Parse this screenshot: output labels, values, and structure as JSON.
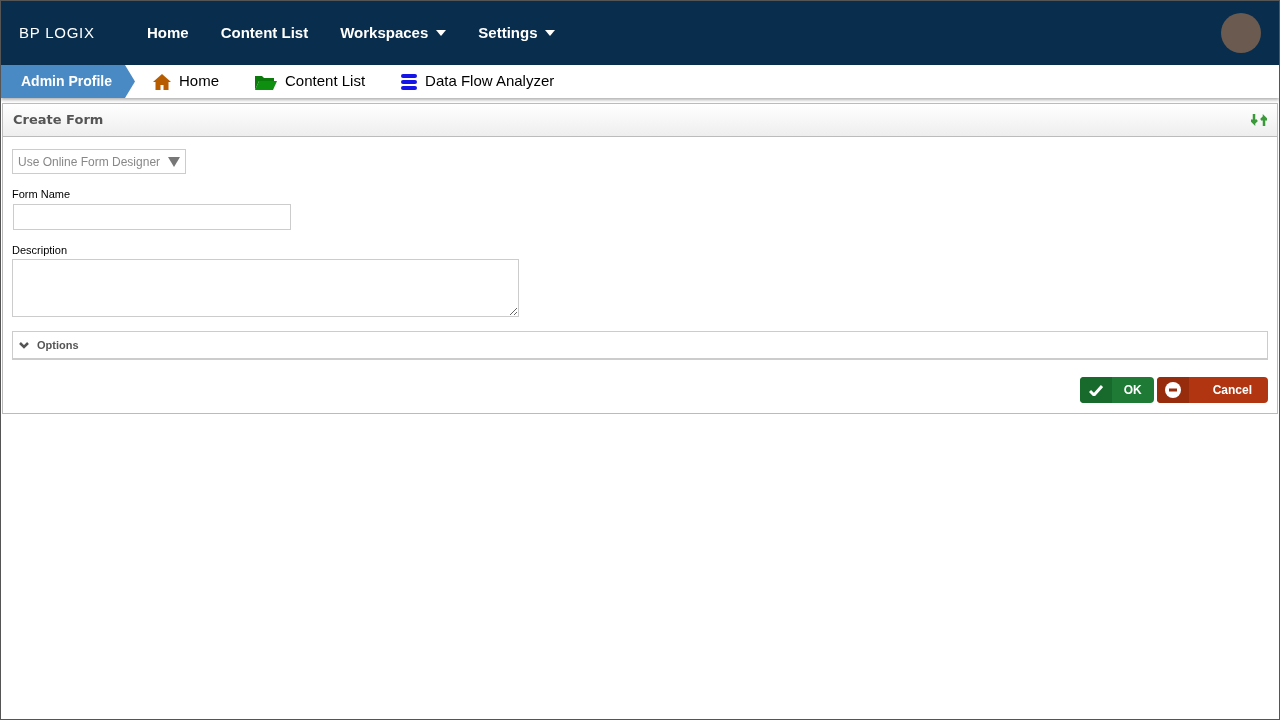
{
  "header": {
    "logo": "BP LOGIX",
    "nav": [
      {
        "label": "Home",
        "dropdown": false
      },
      {
        "label": "Content List",
        "dropdown": false
      },
      {
        "label": "Workspaces",
        "dropdown": true
      },
      {
        "label": "Settings",
        "dropdown": true
      }
    ]
  },
  "breadcrumb": {
    "profile": "Admin Profile",
    "items": [
      {
        "label": "Home",
        "kind": "home"
      },
      {
        "label": "Content List",
        "kind": "folder"
      },
      {
        "label": "Data Flow Analyzer",
        "kind": "database"
      }
    ]
  },
  "panel": {
    "title": "Create Form",
    "designer": "Use Online Form Designer",
    "fields": [
      {
        "label": "Form Name",
        "kind": "text"
      },
      {
        "label": "Description",
        "kind": "textarea"
      }
    ],
    "options": {
      "label": "Options",
      "expanded": false
    },
    "buttons": [
      {
        "label": "OK",
        "kind": "ok"
      },
      {
        "label": "Cancel",
        "kind": "cancel"
      }
    ]
  }
}
